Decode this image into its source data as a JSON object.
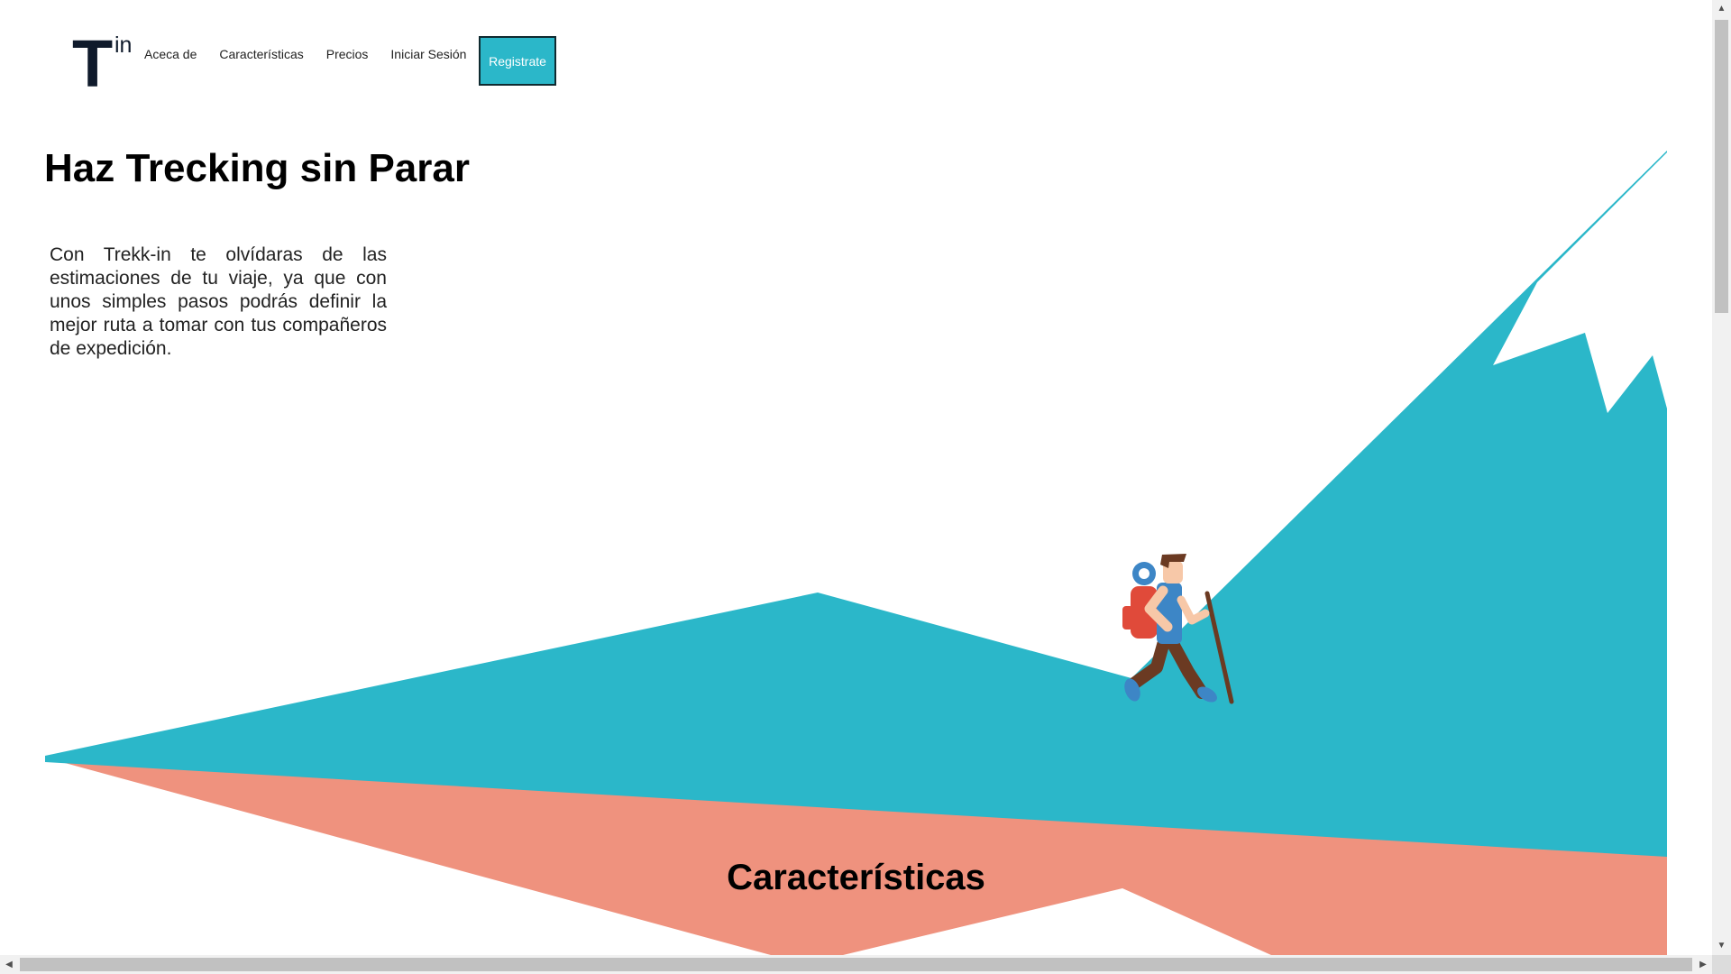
{
  "logo": {
    "letter": "T",
    "suffix": "in"
  },
  "nav": {
    "items": [
      {
        "label": "Aceca de"
      },
      {
        "label": "Características"
      },
      {
        "label": "Precios"
      },
      {
        "label": "Iniciar Sesión"
      }
    ],
    "signup_label": "Registrate"
  },
  "hero": {
    "title": "Haz Trecking sin Parar",
    "text": "Con Trekk-in te olvídaras de las estimaciones de tu viaje, ya que con unos simples pasos podrás definir la mejor ruta a tomar con tus compañeros de expedición."
  },
  "features": {
    "title": "Características"
  },
  "colors": {
    "mountain": "#2bb7c9",
    "salmon": "#ef927e",
    "dark": "#0f1a2b",
    "hiker_backpack": "#e04a3a",
    "hiker_shirt": "#3d86c6",
    "hiker_pants": "#6b3a22",
    "hiker_skin": "#f7c8a8"
  },
  "icons": {
    "scroll_up": "▲",
    "scroll_down": "▼",
    "scroll_left": "◀",
    "scroll_right": "▶"
  }
}
